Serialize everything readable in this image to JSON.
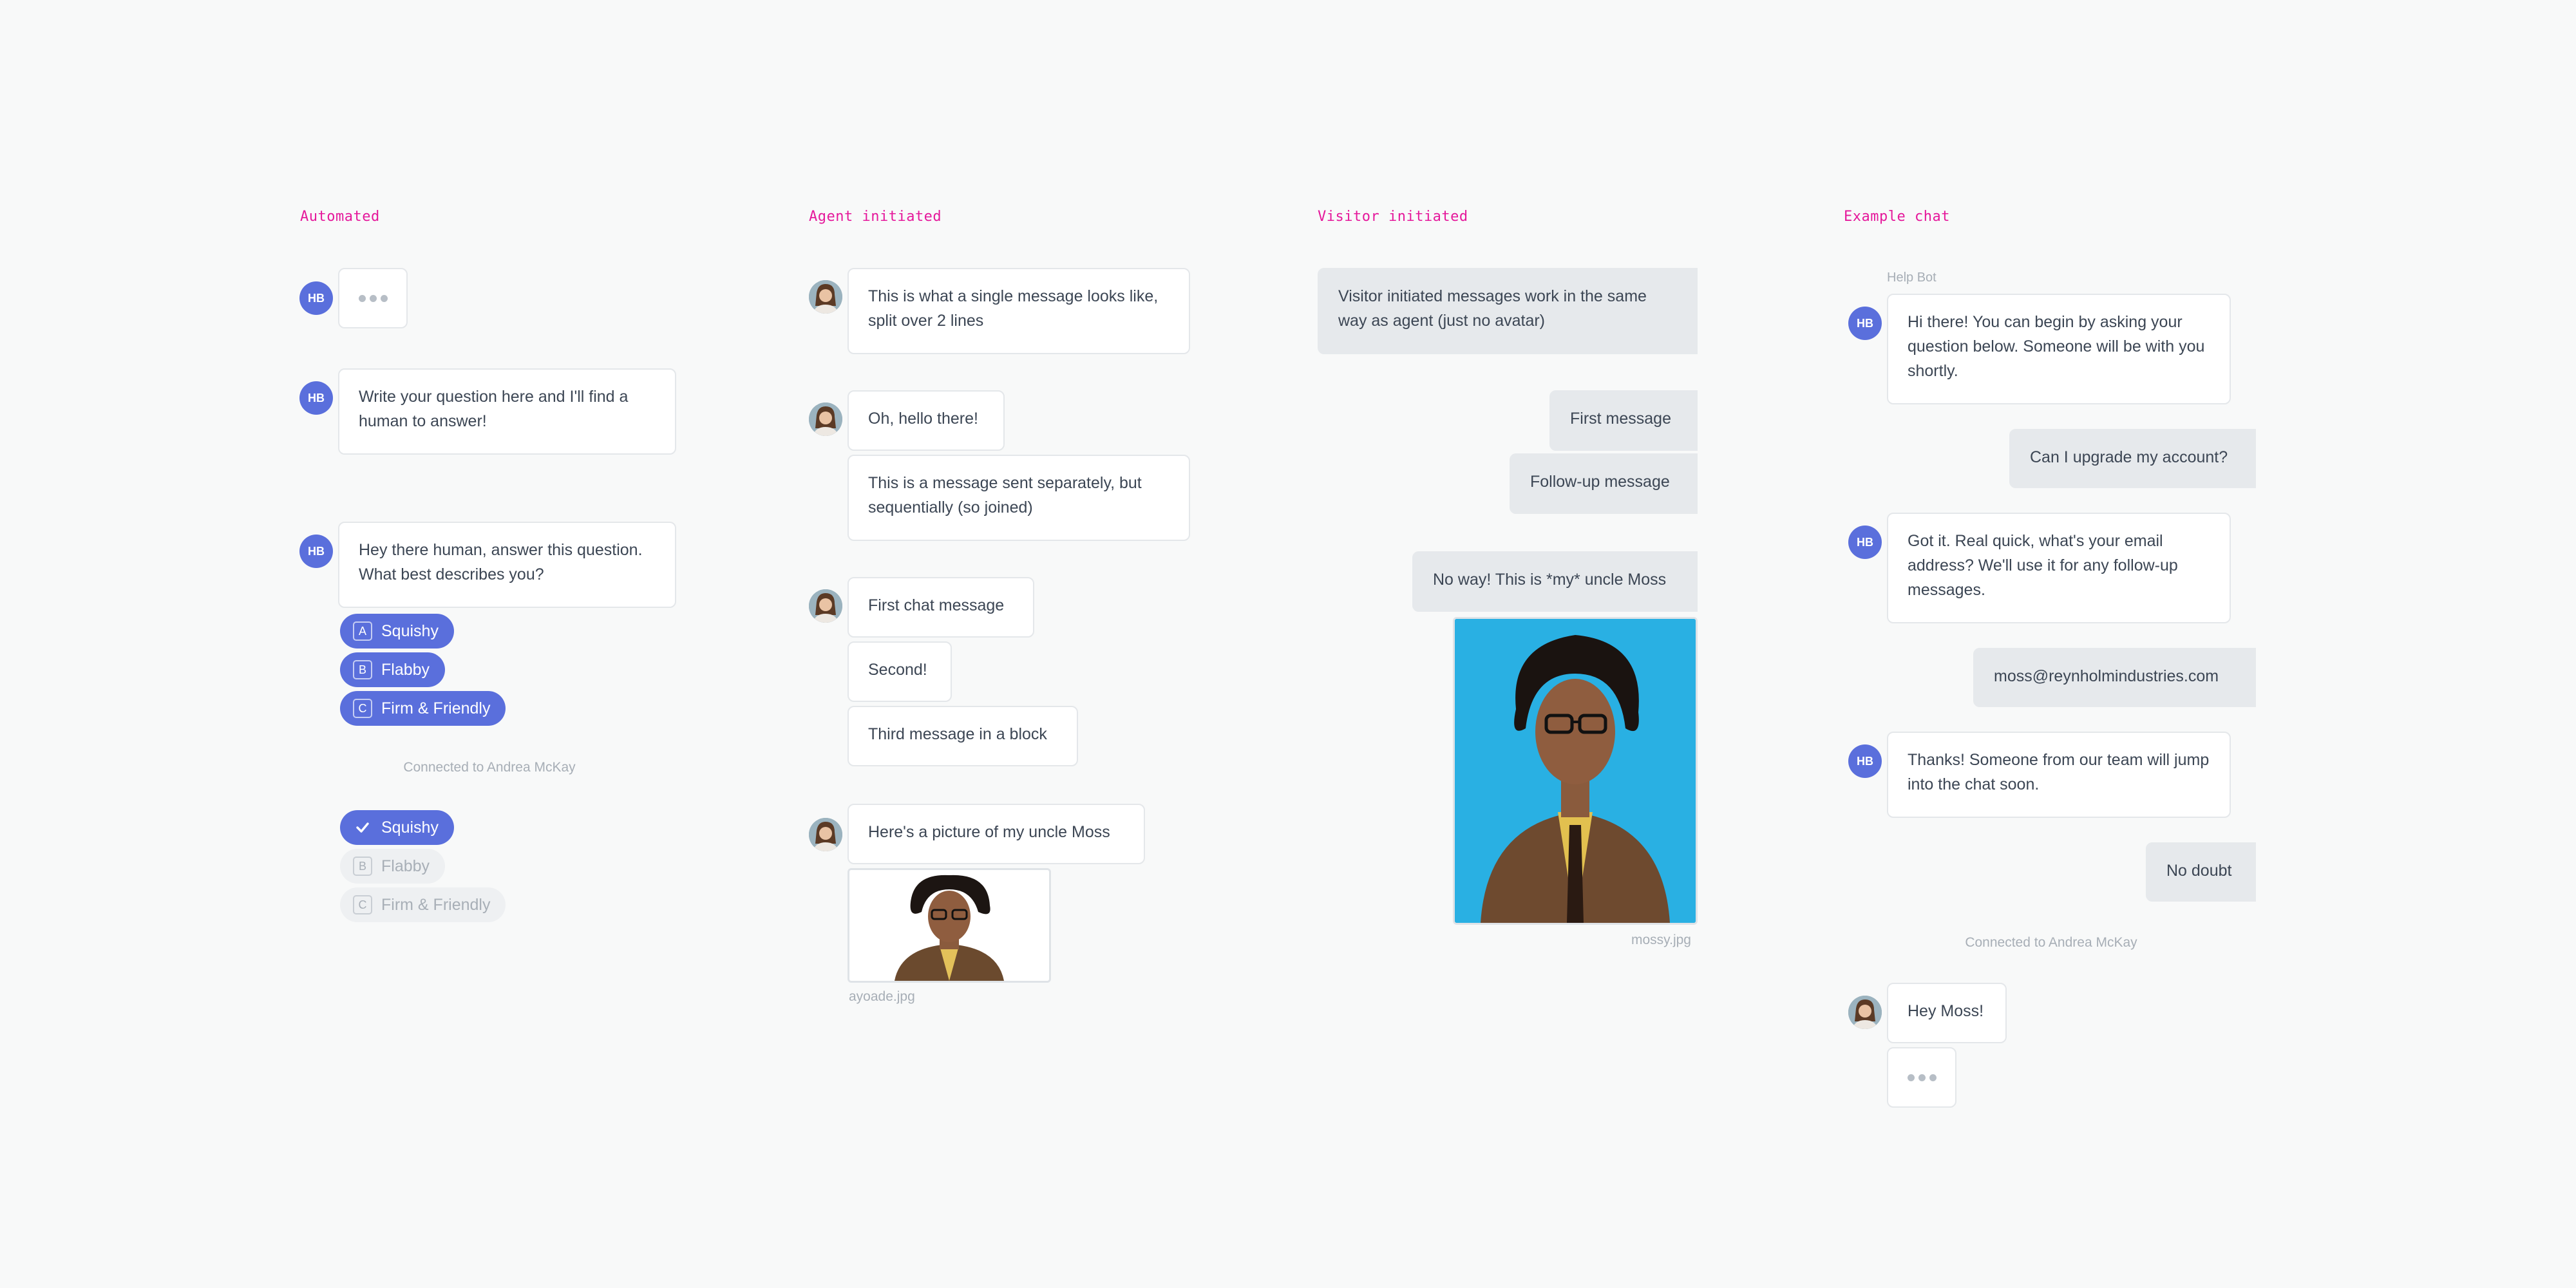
{
  "columns": {
    "automated": "Automated",
    "agent": "Agent initiated",
    "visitor": "Visitor initiated",
    "example": "Example chat"
  },
  "bot": {
    "initials": "HB",
    "name": "Help Bot"
  },
  "automated": {
    "msg1": "Write your question here and I'll find a human to answer!",
    "msg2": "Hey there human, answer this question. What best describes you?",
    "choices": [
      {
        "key": "A",
        "label": "Squishy"
      },
      {
        "key": "B",
        "label": "Flabby"
      },
      {
        "key": "C",
        "label": "Firm & Friendly"
      }
    ],
    "connected": "Connected to Andrea McKay",
    "answered": [
      {
        "key": "check",
        "label": "Squishy",
        "state": "selected"
      },
      {
        "key": "B",
        "label": "Flabby",
        "state": "disabled"
      },
      {
        "key": "C",
        "label": "Firm & Friendly",
        "state": "disabled"
      }
    ]
  },
  "agent": {
    "msg1": "This is what a single message looks like, split over 2 lines",
    "msg2a": "Oh, hello there!",
    "msg2b": "This is a message sent separately, but sequentially (so joined)",
    "msg3a": "First chat message",
    "msg3b": "Second!",
    "msg3c": "Third message in a block",
    "msg4": "Here's a picture of my uncle Moss",
    "file": "ayoade.jpg"
  },
  "visitor": {
    "msg1": "Visitor initiated messages work in the same way as agent (just no avatar)",
    "msg2a": "First message",
    "msg2b": "Follow-up message",
    "msg3": "No way! This is *my* uncle Moss",
    "file": "mossy.jpg"
  },
  "example": {
    "bot1": "Hi there! You can begin by asking your question below. Someone will be with you shortly.",
    "user1": "Can I upgrade my account?",
    "bot2": "Got it. Real quick, what's your email address? We'll use it for any follow-up messages.",
    "user2": "moss@reynholmindustries.com",
    "bot3": "Thanks! Someone from our team will jump into the chat soon.",
    "user3": "No doubt",
    "connected": "Connected to Andrea McKay",
    "agent1": "Hey Moss!"
  },
  "colors": {
    "accent": "#5a6fdc",
    "label": "#e5189b",
    "visitor_bubble": "#e6e9ec",
    "photo_bg": "#29b0e3"
  }
}
